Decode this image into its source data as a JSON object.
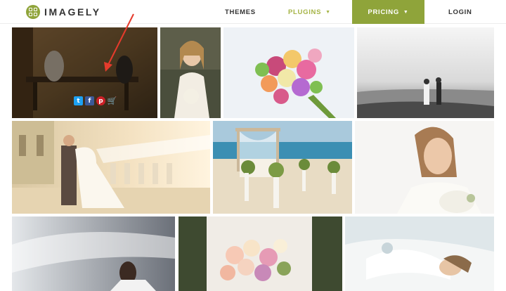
{
  "brand": {
    "name": "IMAGELY",
    "accent": "#8fa43a",
    "accent_text": "#a5b446"
  },
  "nav": {
    "themes": "THEMES",
    "plugins": "PLUGINS",
    "pricing": "PRICING",
    "login": "LOGIN"
  },
  "gallery": {
    "hover_actions": {
      "twitter": "t",
      "facebook": "f",
      "pinterest": "p",
      "cart": "🛒"
    },
    "photos": [
      {
        "subject": "couple on park bench (hovered)"
      },
      {
        "subject": "smiling bride with bouquet"
      },
      {
        "subject": "colorful rose bouquet"
      },
      {
        "subject": "couple walking on beach, black and white"
      },
      {
        "subject": "groom dipping bride by balustrade"
      },
      {
        "subject": "beach wedding arch with floral aisle"
      },
      {
        "subject": "bride looking down with bouquet"
      },
      {
        "subject": "bride under flowing veil"
      },
      {
        "subject": "pastel wedding bouquet"
      },
      {
        "subject": "bride lying in white dress"
      }
    ]
  },
  "annotation": {
    "arrow_color": "#e53b2c"
  }
}
